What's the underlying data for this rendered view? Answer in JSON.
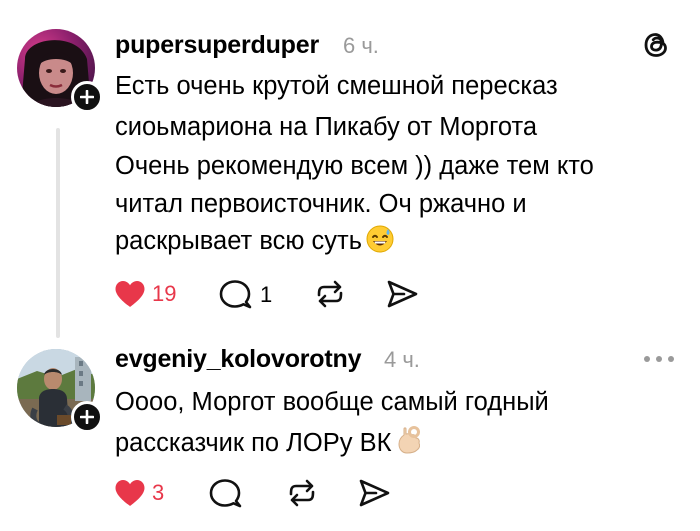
{
  "app": {
    "logo_icon": "threads-logo-icon",
    "like_color": "#e8374a",
    "secondary_text_color": "#9a9a9a"
  },
  "posts": [
    {
      "username": "pupersuperduper",
      "time": "6 ч.",
      "text_lines": [
        "Есть очень крутой смешной пересказ",
        "сиоьмариона на Пикабу от Моргота",
        "Очень рекомендую всем )) даже тем кто",
        "читал первоисточник. Оч ржачно и",
        "раскрывает всю суть"
      ],
      "emoji": "grinning-sweat-emoji",
      "likes": "19",
      "liked": true,
      "replies": "1",
      "icons": [
        "heart-icon",
        "comment-icon",
        "repost-icon",
        "share-icon"
      ]
    },
    {
      "username": "evgeniy_kolovorotny",
      "time": "4 ч.",
      "text_lines": [
        "Оооо, Моргот вообще самый годный",
        "рассказчик по ЛОРу ВК"
      ],
      "emoji": "ok-hand-emoji",
      "likes": "3",
      "liked": true,
      "replies": "",
      "icons": [
        "heart-icon",
        "comment-icon",
        "repost-icon",
        "share-icon"
      ]
    }
  ]
}
